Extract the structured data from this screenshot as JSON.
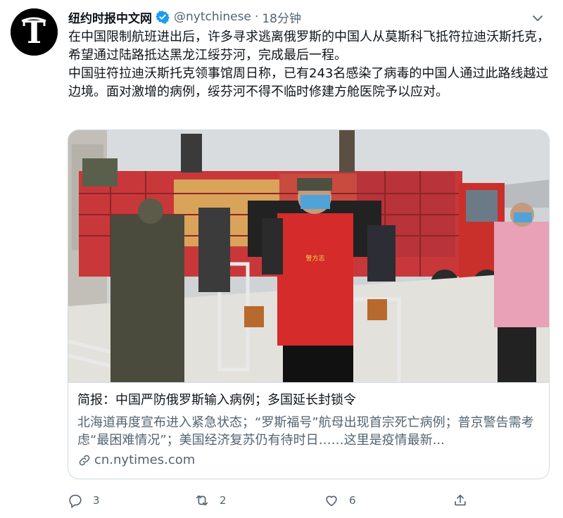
{
  "author": {
    "display_name": "纽约时报中文网",
    "handle": "@nytchinese",
    "separator": "·",
    "time": "18分钟",
    "avatar_icon": "nyt-logo-icon",
    "verified_color": "#1d9bf0"
  },
  "tweet": {
    "text": "在中国限制航班进出后，许多寻求逃离俄罗斯的中国人从莫斯科飞抵符拉迪沃斯托克，希望通过陆路抵达黑龙江绥芬河，完成最后一程。\n中国驻符拉迪沃斯托克领事馆周日称，已有243名感染了病毒的中国人通过此路线越过边境。面对激增的病例，绥芬河不得不临时修建方舱医院予以应对。"
  },
  "card": {
    "title": "简报：中国严防俄罗斯输入病例；多国延长封锁令",
    "description": "北海道再度宣布进入紧急状态；“罗斯福号”航母出现首宗死亡病例；普京警告需考虑“最困难情况”；美国经济复苏仍有待时日……这里是疫情最新...",
    "link": "cn.nytimes.com",
    "vest_text": "警方志"
  },
  "actions": {
    "reply_count": "3",
    "retweet_count": "2",
    "like_count": "6"
  },
  "colors": {
    "text_primary": "#0f1419",
    "text_secondary": "#536471",
    "border": "#cfd9de"
  }
}
